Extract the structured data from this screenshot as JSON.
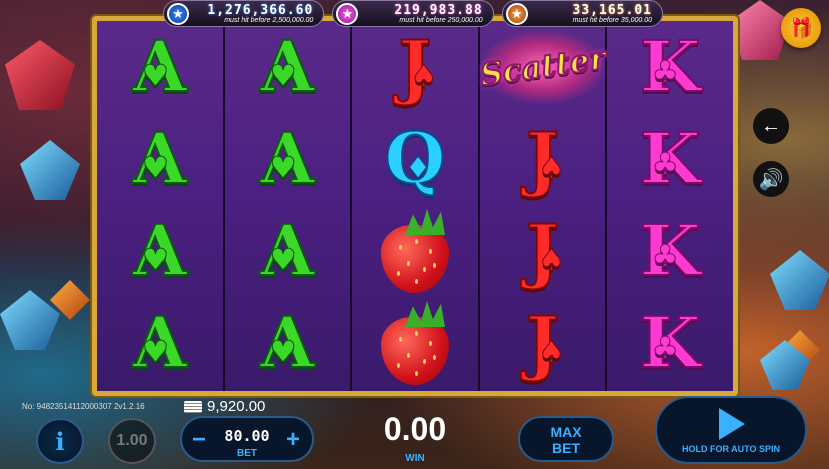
{
  "jackpots": [
    {
      "icon": "star-icon",
      "value": "1,276,366.60",
      "note": "must hit before 2,500,000.00",
      "color": "#1a5aff"
    },
    {
      "icon": "star-icon",
      "value": "219,983.88",
      "note": "must hit before 250,000.00",
      "color": "#d43ad0"
    },
    {
      "icon": "star-icon",
      "value": "33,165.01",
      "note": "must hit before 35,000.00",
      "color": "#e0781a"
    }
  ],
  "reels": [
    [
      "A",
      "A",
      "A",
      "A"
    ],
    [
      "A",
      "A",
      "A",
      "A"
    ],
    [
      "J",
      "Q",
      "strawberry",
      "strawberry"
    ],
    [
      "Scatter",
      "J",
      "J",
      "J"
    ],
    [
      "K",
      "K",
      "K",
      "K"
    ]
  ],
  "scatter_label": "Scatter",
  "ticket_no": "No: 94823514112000307 2v1.2.16",
  "balance": "9,920.00",
  "speed": "1.00",
  "bet": {
    "value": "80.00",
    "label": "BET",
    "minus": "−",
    "plus": "+"
  },
  "win": {
    "value": "0.00",
    "label": "WIN"
  },
  "max_bet": {
    "line1": "MAX",
    "line2": "BET"
  },
  "spin": {
    "label": "HOLD FOR AUTO SPIN"
  },
  "info_label": "i",
  "side_buttons": {
    "back_icon": "back-arrow-icon",
    "sound_icon": "speaker-icon"
  },
  "gift_icon": "gift-icon"
}
